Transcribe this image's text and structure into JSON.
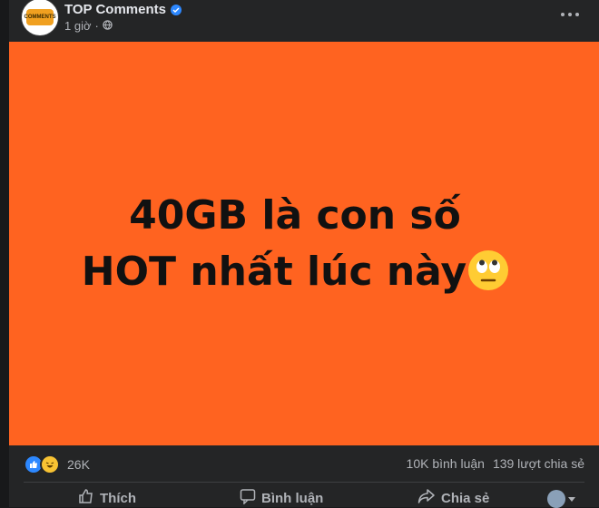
{
  "post": {
    "page_name": "TOP Comments",
    "avatar_text": "COMMENTS",
    "time": "1 giờ",
    "image_line1": "40GB là con số",
    "image_line2": "HOT nhất lúc này"
  },
  "stats": {
    "reaction_count": "26K",
    "comments": "10K bình luận",
    "shares": "139 lượt chia sẻ"
  },
  "actions": {
    "like": "Thích",
    "comment": "Bình luận",
    "share": "Chia sẻ"
  },
  "colors": {
    "image_bg": "#ff6320",
    "card_bg": "#242526",
    "verified": "#2d88ff"
  }
}
